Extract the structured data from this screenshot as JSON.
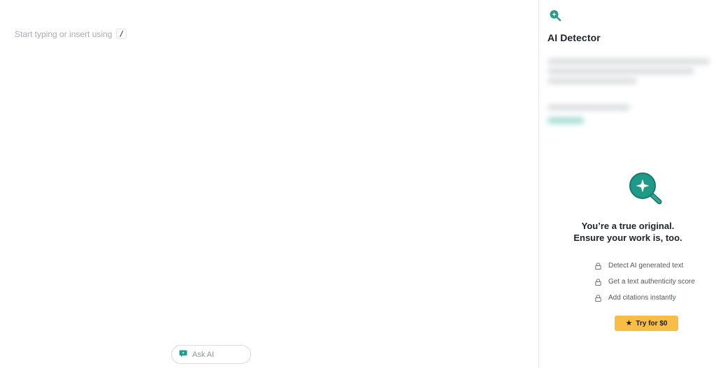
{
  "editor": {
    "placeholder": "Start typing or insert using",
    "shortcut_key": "/"
  },
  "ask_ai": {
    "label": "Ask AI",
    "icon": "chat-sparkle-icon"
  },
  "panel": {
    "logo_icon": "magnifier-sparkle-icon",
    "title": "AI Detector",
    "headline_line1": "You’re a true original.",
    "headline_line2": "Ensure your work is, too.",
    "features": [
      {
        "label": "Detect AI generated text",
        "icon": "lock-icon"
      },
      {
        "label": "Get a text authenticity score",
        "icon": "lock-icon"
      },
      {
        "label": "Add citations instantly",
        "icon": "lock-icon"
      }
    ],
    "cta_label": "Try for $0",
    "cta_icon": "star-icon"
  },
  "colors": {
    "accent_teal": "#1f9e8b",
    "cta_yellow": "#f7bd44",
    "placeholder_gray": "#a7abb0"
  }
}
